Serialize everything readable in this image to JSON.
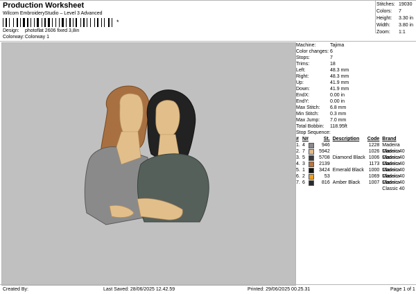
{
  "header": {
    "title": "Production Worksheet",
    "subtitle": "Wilcom EmbroideryStudio – Level 3 Advanced",
    "barcode_suffix": "*",
    "design_label": "Design:",
    "design_value": "photoflat 2606 fixed 3,8in",
    "colorway_label": "Colorway:",
    "colorway_value": "Colorway 1"
  },
  "stats": [
    {
      "label": "Stitches:",
      "value": "19030"
    },
    {
      "label": "Colors:",
      "value": "7"
    },
    {
      "label": "Height:",
      "value": "3.30 in"
    },
    {
      "label": "Width:",
      "value": "3.80 in"
    },
    {
      "label": "Zoom:",
      "value": "1:1"
    }
  ],
  "machine_info": [
    {
      "label": "Machine:",
      "value": "Tajima"
    },
    {
      "label": "Color changes:",
      "value": "6"
    },
    {
      "label": "Stops:",
      "value": "7"
    },
    {
      "label": "Trims:",
      "value": "18"
    },
    {
      "label": "Left:",
      "value": "48.3 mm"
    },
    {
      "label": "Right:",
      "value": "48.3 mm"
    },
    {
      "label": "Up:",
      "value": "41.9 mm"
    },
    {
      "label": "Down:",
      "value": "41.9 mm"
    },
    {
      "label": "EndX:",
      "value": "0.00 in"
    },
    {
      "label": "EndY:",
      "value": "0.00 in"
    },
    {
      "label": "Max Stitch:",
      "value": "6.8 mm"
    },
    {
      "label": "Min Stitch:",
      "value": "0.3 mm"
    },
    {
      "label": "Max Jump:",
      "value": "7.0 mm"
    },
    {
      "label": "Total Bobbin:",
      "value": "118.95ft"
    }
  ],
  "stop_sequence": {
    "title": "Stop Sequence:",
    "headers": {
      "idx": "#",
      "stop": "N#",
      "st": "St.",
      "desc": "Description",
      "code": "Code",
      "brand": "Brand"
    },
    "rows": [
      {
        "idx": "1.",
        "stop": "4",
        "color": "#8a8a8a",
        "num": "946",
        "desc": "",
        "code": "1228",
        "brand": "Madeira Classic 40"
      },
      {
        "idx": "2.",
        "stop": "7",
        "color": "#e0b88a",
        "num": "5942",
        "desc": "",
        "code": "1026",
        "brand": "Madeira Classic 40"
      },
      {
        "idx": "3.",
        "stop": "5",
        "color": "#3b3b3b",
        "num": "5708",
        "desc": "Diamond Black",
        "code": "1006",
        "brand": "Madeira Classic 40"
      },
      {
        "idx": "4.",
        "stop": "3",
        "color": "#b8763c",
        "num": "2139",
        "desc": "",
        "code": "1173",
        "brand": "Madeira Classic 40"
      },
      {
        "idx": "5.",
        "stop": "1",
        "color": "#141414",
        "num": "3424",
        "desc": "Emerald Black",
        "code": "1000",
        "brand": "Madeira Classic 40"
      },
      {
        "idx": "6.",
        "stop": "2",
        "color": "#f0a020",
        "num": "53",
        "desc": "",
        "code": "1069",
        "brand": "Madeira Classic 40"
      },
      {
        "idx": "7.",
        "stop": "6",
        "color": "#2a2a2a",
        "num": "816",
        "desc": "Amber Black",
        "code": "1007",
        "brand": "Madeira Classic 40"
      }
    ]
  },
  "footer": {
    "created": "Created By:",
    "last_saved": "Last Saved: 28/06/2025 12.42.59",
    "printed": "Printed: 29/06/2025 00.25.31",
    "page": "Page 1 of 1"
  }
}
